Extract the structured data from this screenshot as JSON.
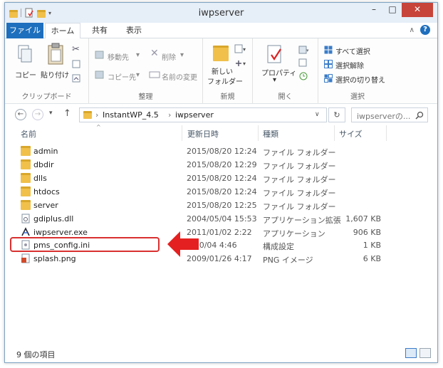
{
  "window": {
    "title": "iwpserver"
  },
  "tabs": [
    {
      "label": "ファイル"
    },
    {
      "label": "ホーム"
    },
    {
      "label": "共有"
    },
    {
      "label": "表示"
    }
  ],
  "ribbon": {
    "clipboard": {
      "label": "クリップボード",
      "copy": "コピー",
      "paste": "貼り付け"
    },
    "organize": {
      "label": "整理",
      "move_to": "移動先",
      "copy_to": "コピー先",
      "delete": "削除",
      "rename": "名前の変更"
    },
    "new": {
      "label": "新規",
      "new_folder_line1": "新しい",
      "new_folder_line2": "フォルダー"
    },
    "open": {
      "label": "開く",
      "properties": "プロパティ"
    },
    "select": {
      "label": "選択",
      "select_all": "すべて選択",
      "select_none": "選択解除",
      "invert": "選択の切り替え"
    }
  },
  "address": {
    "crumbs": [
      "InstantWP_4.5",
      "iwpserver"
    ],
    "search_placeholder": "iwpserverの..."
  },
  "columns": {
    "name": "名前",
    "date": "更新日時",
    "type": "種類",
    "size": "サイズ"
  },
  "files": [
    {
      "name": "admin",
      "date": "2015/08/20 12:24",
      "type": "ファイル フォルダー",
      "size": "",
      "icon": "folder-icon"
    },
    {
      "name": "dbdir",
      "date": "2015/08/20 12:29",
      "type": "ファイル フォルダー",
      "size": "",
      "icon": "folder-icon"
    },
    {
      "name": "dlls",
      "date": "2015/08/20 12:24",
      "type": "ファイル フォルダー",
      "size": "",
      "icon": "folder-icon"
    },
    {
      "name": "htdocs",
      "date": "2015/08/20 12:24",
      "type": "ファイル フォルダー",
      "size": "",
      "icon": "folder-icon"
    },
    {
      "name": "server",
      "date": "2015/08/20 12:25",
      "type": "ファイル フォルダー",
      "size": "",
      "icon": "folder-icon"
    },
    {
      "name": "gdiplus.dll",
      "date": "2004/05/04 15:53",
      "type": "アプリケーション拡張",
      "size": "1,607 KB",
      "icon": "dll-file-icon"
    },
    {
      "name": "iwpserver.exe",
      "date": "2011/01/02 2:22",
      "type": "アプリケーション",
      "size": "906 KB",
      "icon": "exe-file-icon"
    },
    {
      "name": "pms_config.ini",
      "date": "2/10/04 4:46",
      "type": "構成設定",
      "size": "1 KB",
      "icon": "ini-file-icon"
    },
    {
      "name": "splash.png",
      "date": "2009/01/26 4:17",
      "type": "PNG イメージ",
      "size": "6 KB",
      "icon": "png-file-icon"
    }
  ],
  "status": {
    "text": "9 個の項目"
  },
  "colors": {
    "accent": "#1e6fbd",
    "highlight": "#d93030",
    "folder": "#f0c04a"
  }
}
